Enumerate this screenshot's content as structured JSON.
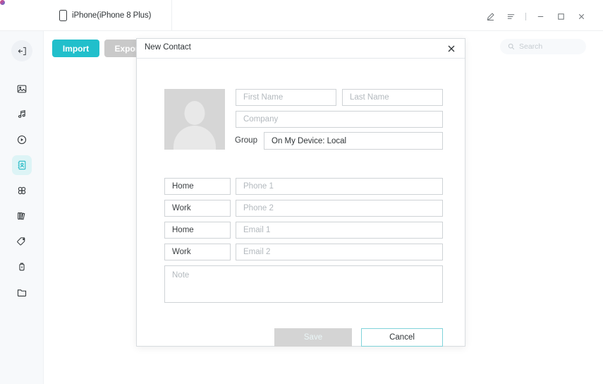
{
  "window": {
    "device_tab_label": "iPhone(iPhone 8 Plus)",
    "device_icon": "phone-icon",
    "controls": [
      {
        "name": "edit-pencil-icon",
        "label": ""
      },
      {
        "name": "menu-icon",
        "label": ""
      },
      {
        "name": "minimize-icon",
        "label": ""
      },
      {
        "name": "maximize-icon",
        "label": ""
      },
      {
        "name": "close-icon",
        "label": ""
      }
    ],
    "accent_color": "#21bfcb"
  },
  "sidebar": {
    "collapse_icon": "collapse-sidebar-icon",
    "items": [
      {
        "name": "photos",
        "icon": "image-icon",
        "active": false
      },
      {
        "name": "music",
        "icon": "music-note-icon",
        "active": false
      },
      {
        "name": "videos",
        "icon": "play-circle-icon",
        "active": false
      },
      {
        "name": "contacts",
        "icon": "contacts-book-icon",
        "active": true
      },
      {
        "name": "apps",
        "icon": "apps-grid-icon",
        "active": false
      },
      {
        "name": "books",
        "icon": "books-icon",
        "active": false
      },
      {
        "name": "bookmarks",
        "icon": "tag-icon",
        "active": false
      },
      {
        "name": "backup",
        "icon": "battery-icon",
        "active": false
      },
      {
        "name": "files",
        "icon": "folder-icon",
        "active": false
      }
    ]
  },
  "toolbar": {
    "import_label": "Import",
    "export_label": "Export",
    "import_color": "#21bfcb",
    "export_color": "#c9c9c9"
  },
  "search": {
    "placeholder": "Search",
    "icon": "search-icon"
  },
  "dialog": {
    "title": "New Contact",
    "close_icon": "close-icon",
    "avatar": {
      "name": "contact-avatar-placeholder"
    },
    "name_fields": {
      "first_placeholder": "First Name",
      "first_value": "",
      "last_placeholder": "Last Name",
      "last_value": "",
      "company_placeholder": "Company",
      "company_value": ""
    },
    "group": {
      "label": "Group",
      "value": "On My Device: Local"
    },
    "rows": [
      {
        "type_label": "Home",
        "placeholder": "Phone 1",
        "value": ""
      },
      {
        "type_label": "Work",
        "placeholder": "Phone 2",
        "value": ""
      },
      {
        "type_label": "Home",
        "placeholder": "Email 1",
        "value": ""
      },
      {
        "type_label": "Work",
        "placeholder": "Email 2",
        "value": ""
      }
    ],
    "note": {
      "placeholder": "Note",
      "value": ""
    },
    "actions": {
      "save_label": "Save",
      "save_enabled": false,
      "cancel_label": "Cancel"
    }
  }
}
